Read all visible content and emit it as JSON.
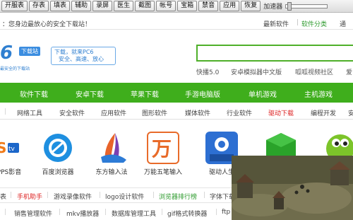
{
  "toolbar": {
    "buttons": [
      "开服表",
      "存表",
      "填表",
      "辅助",
      "录屏",
      "医生",
      "截图",
      "帐号",
      "宝箱",
      "禁音",
      "应用",
      "恢复"
    ],
    "speed_label": "加速器"
  },
  "infobar": {
    "welcome": "：您身边最放心的安全下载站！",
    "latest": "最新软件",
    "category": "软件分类",
    "more": "通"
  },
  "logo": {
    "mark": "6",
    "badge": "下载站",
    "subtitle": "最安全的下载站",
    "slogan_line1": "下载，就来PC6",
    "slogan_line2": "安全、高速、放心"
  },
  "hot": [
    "快播5.0",
    "安卓模拟器中文版",
    "呱呱视频社区",
    "爱"
  ],
  "nav": [
    "软件下载",
    "安卓下载",
    "苹果下载",
    "手游电脑版",
    "单机游戏",
    "主机游戏"
  ],
  "subnav": {
    "items": [
      "网络工具",
      "安全软件",
      "应用软件",
      "图形软件",
      "媒体软件",
      "行业软件",
      "驱动下载",
      "编程开发",
      "安"
    ],
    "active_index": 6
  },
  "apps": [
    {
      "label": "PPS影音",
      "icon": "pps-icon"
    },
    {
      "label": "百度浏览器",
      "icon": "baidu-browser-icon"
    },
    {
      "label": "东方输入法",
      "icon": "dongfang-ime-icon"
    },
    {
      "label": "万能五笔输入",
      "icon": "wanneng-wubi-icon"
    },
    {
      "label": "驱动人生",
      "icon": "driver-life-icon"
    },
    {
      "label": "",
      "icon": "green-cube-icon"
    },
    {
      "label": "",
      "icon": "green-monster-icon"
    }
  ],
  "tags_row1": [
    {
      "text": "表",
      "style": ""
    },
    {
      "text": "手机助手",
      "style": "red"
    },
    {
      "text": "游戏录像软件",
      "style": ""
    },
    {
      "text": "logo设计软件",
      "style": ""
    },
    {
      "text": "浏览器排行榜",
      "style": "green"
    },
    {
      "text": "字体下载",
      "style": ""
    }
  ],
  "tags_row2": [
    "销售管理软件",
    "mkv播放器",
    "数据库管理工具",
    "gif格式转换器",
    "ftp"
  ],
  "colors": {
    "nav_green": "#3fae1c",
    "link_red": "#dd2222",
    "link_green": "#2f9b2f",
    "logo_blue": "#2f7fd0"
  }
}
